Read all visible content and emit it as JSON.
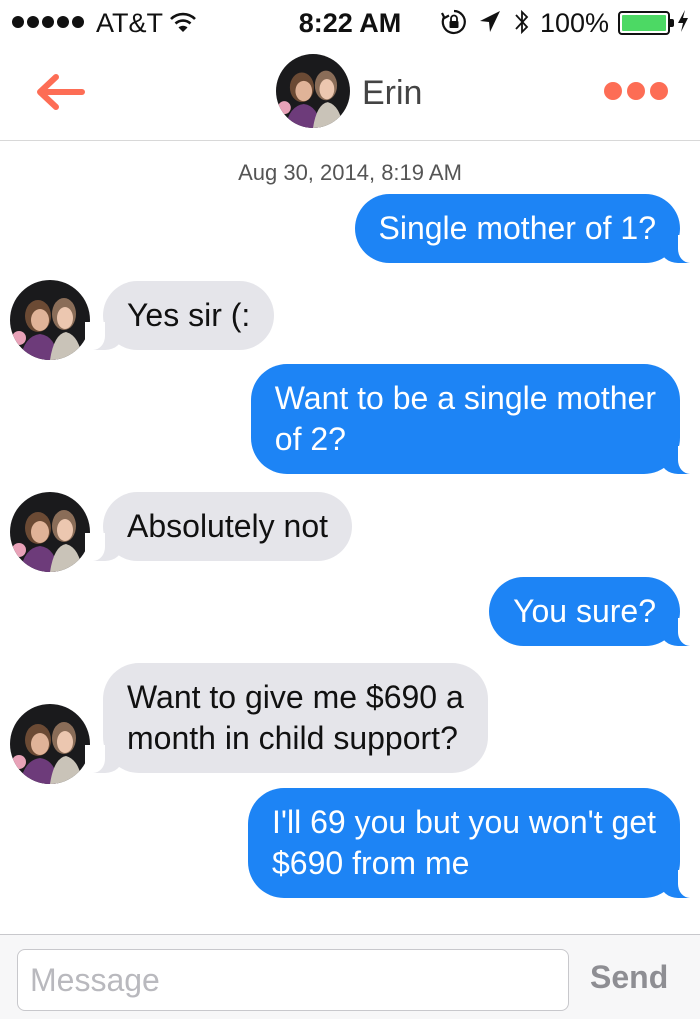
{
  "status_bar": {
    "carrier": "AT&T",
    "time": "8:22 AM",
    "battery_percent": "100%",
    "battery_level": 1.0
  },
  "nav": {
    "back_icon": "back-arrow-icon",
    "contact_name": "Erin",
    "more_icon": "more-dots-icon",
    "accent_color": "#fd6d55"
  },
  "conversation": {
    "timestamp": "Aug 30, 2014, 8:19 AM",
    "messages": [
      {
        "direction": "out",
        "lines": [
          "Single mother of 1?"
        ]
      },
      {
        "direction": "in",
        "lines": [
          "Yes sir (:"
        ]
      },
      {
        "direction": "out",
        "lines": [
          "Want to be a single mother",
          "of 2?"
        ]
      },
      {
        "direction": "in",
        "lines": [
          "Absolutely not"
        ]
      },
      {
        "direction": "out",
        "lines": [
          "You sure?"
        ]
      },
      {
        "direction": "in",
        "lines": [
          "Want to give me $690 a",
          "month in child support?"
        ]
      },
      {
        "direction": "out",
        "lines": [
          "I'll 69 you but you won't get",
          "$690 from me"
        ]
      }
    ],
    "outgoing_color": "#1d84f5",
    "incoming_color": "#e5e5ea"
  },
  "input_bar": {
    "placeholder": "Message",
    "send_label": "Send"
  }
}
